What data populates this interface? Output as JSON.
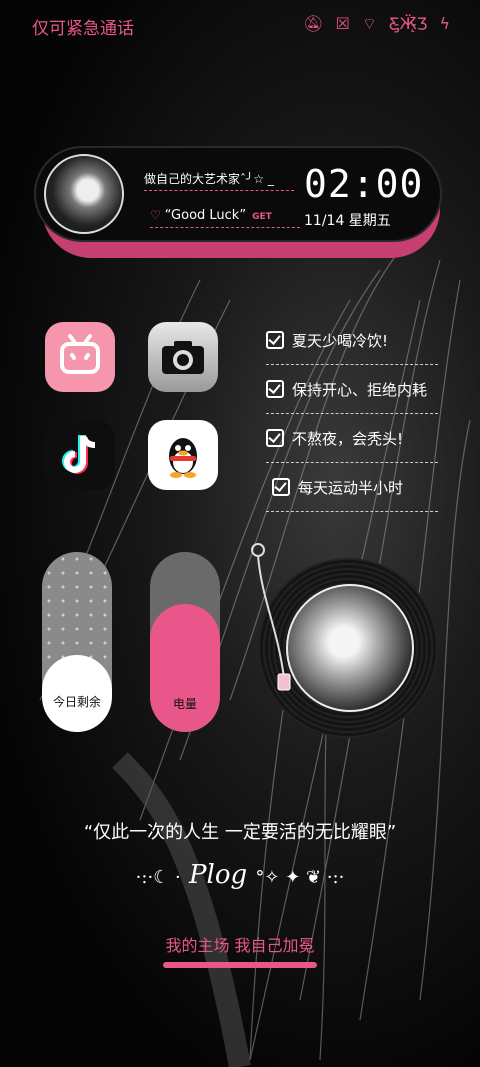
{
  "status_bar": {
    "carrier": "仅可紧急通话",
    "icons": [
      "mute-icon",
      "sim-off-icon",
      "wifi-icon",
      "butterfly-icon",
      "charging-icon"
    ]
  },
  "widget": {
    "tagline": "做自己的大艺术家ˆ╯☆ _",
    "luck_text": "“Good Luck”",
    "get_label": "GET",
    "time": "02:00",
    "date": "11/14  星期五"
  },
  "apps": [
    {
      "name": "bilibili",
      "icon": "bilibili-icon"
    },
    {
      "name": "camera",
      "icon": "camera-icon"
    },
    {
      "name": "tiktok",
      "icon": "tiktok-icon"
    },
    {
      "name": "qq",
      "icon": "qq-penguin-icon"
    }
  ],
  "todo": [
    "夏天少喝冷饮!",
    "保持开心、拒绝内耗",
    "不熬夜，会秃头!",
    "每天运动半小时"
  ],
  "sliders": {
    "today_label": "今日剩余",
    "today_level": 0.43,
    "battery_label": "电量",
    "battery_level": 0.71
  },
  "quote": "“仅此一次的人生  一定要活的无比耀眼”",
  "plog": {
    "left_deco": "·:·☾ ·",
    "text": "Plog",
    "right_deco": "°✧ ✦ ❦ ·:·"
  },
  "footer_tag": "我的主场 我自己加冕",
  "colors": {
    "accent": "#e8568a",
    "background": "#0a0a0a"
  }
}
